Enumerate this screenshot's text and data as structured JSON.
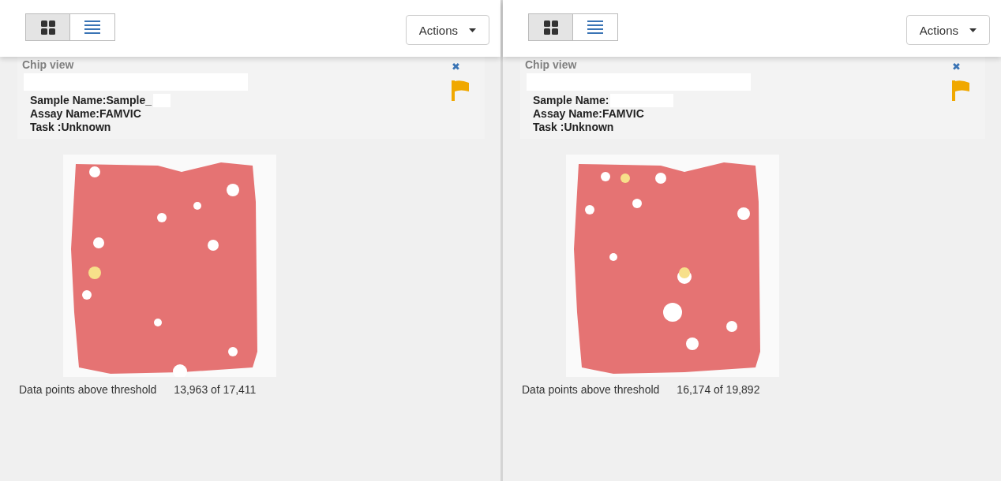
{
  "panels": [
    {
      "view_toggle": [
        {
          "kind": "grid",
          "selected": true
        },
        {
          "kind": "list",
          "selected": false
        }
      ],
      "actions_button": "Actions",
      "card": {
        "title": "Chip view",
        "close": "✖",
        "flagged": true,
        "sample_name": "Sample Name:Sample_",
        "assay_name": "Assay Name:FAMVIC",
        "task": "Task :Unknown"
      },
      "threshold_label": "Data points above threshold",
      "threshold_value": "13,963 of 17,411"
    },
    {
      "view_toggle": [
        {
          "kind": "grid",
          "selected": true
        },
        {
          "kind": "list",
          "selected": false
        }
      ],
      "actions_button": "Actions",
      "card": {
        "title": "Chip view",
        "close": "✖",
        "flagged": true,
        "sample_name": "Sample Name:",
        "assay_name": "Assay Name:FAMVIC",
        "task": "Task :Unknown"
      },
      "threshold_label": "Data points above threshold",
      "threshold_value": "16,174 of 19,892"
    }
  ]
}
